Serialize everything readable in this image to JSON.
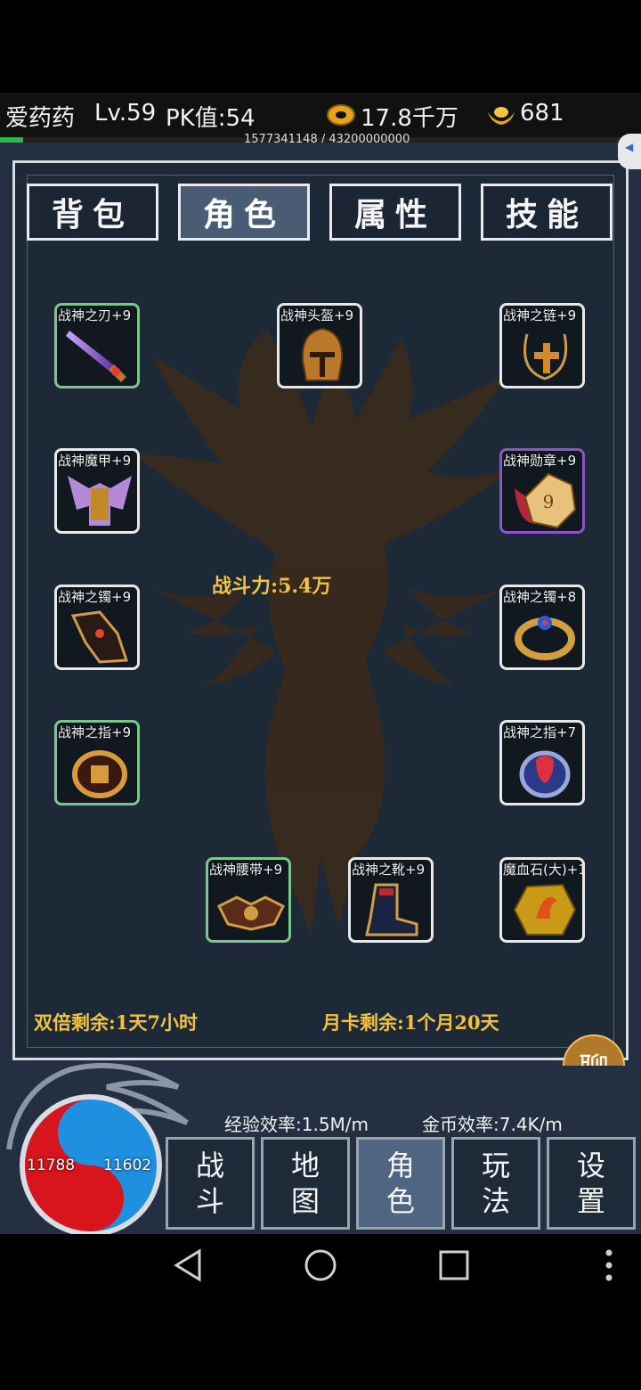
{
  "header": {
    "player_name": "爱药药",
    "level": "Lv.59",
    "pk": "PK值:54",
    "gold": "17.8千万",
    "ingots": "681",
    "exp_progress": "1577341148 / 43200000000",
    "exp_fraction": 0.0365
  },
  "tabs": [
    {
      "label": "背包",
      "active": false
    },
    {
      "label": "角色",
      "active": true
    },
    {
      "label": "属性",
      "active": false
    },
    {
      "label": "技能",
      "active": false
    }
  ],
  "equipment": {
    "weapon": {
      "label": "战神之刃+9",
      "icon": "sword-icon",
      "rarity": "green"
    },
    "helmet": {
      "label": "战神头盔+9",
      "icon": "helmet-icon",
      "rarity": "white"
    },
    "necklace": {
      "label": "战神之链+9",
      "icon": "necklace-icon",
      "rarity": "white"
    },
    "armor": {
      "label": "战神魔甲+9",
      "icon": "armor-icon",
      "rarity": "white"
    },
    "medal": {
      "label": "战神勋章+9",
      "icon": "medal-icon",
      "rarity": "purple"
    },
    "bracelet_left": {
      "label": "战神之镯+9",
      "icon": "gauntlet-icon",
      "rarity": "white"
    },
    "bracelet_right": {
      "label": "战神之镯+8",
      "icon": "bracelet-icon",
      "rarity": "white"
    },
    "ring_left": {
      "label": "战神之指+9",
      "icon": "ring-icon",
      "rarity": "green"
    },
    "ring_right": {
      "label": "战神之指+7",
      "icon": "ring-icon",
      "rarity": "white"
    },
    "belt": {
      "label": "战神腰带+9",
      "icon": "belt-icon",
      "rarity": "green"
    },
    "boots": {
      "label": "战神之靴+9",
      "icon": "boots-icon",
      "rarity": "white"
    },
    "gem": {
      "label": "魔血石(大)+1",
      "icon": "gem-icon",
      "rarity": "white"
    }
  },
  "combat_power": "战斗力:5.4万",
  "double_exp": "双倍剩余:1天7小时",
  "monthly_card": "月卡剩余:1个月20天",
  "chat_button": "聊",
  "efficiency": {
    "exp": "经验效率:1.5M/m",
    "gold": "金币效率:7.4K/m"
  },
  "orb": {
    "hp": "11788",
    "mp": "11602"
  },
  "nav": [
    {
      "label": "战\n斗",
      "active": false
    },
    {
      "label": "地\n图",
      "active": false
    },
    {
      "label": "角\n色",
      "active": true
    },
    {
      "label": "玩\n法",
      "active": false
    },
    {
      "label": "设\n置",
      "active": false
    }
  ],
  "colors": {
    "gold_text": "#f2c23a",
    "panel": "#1e2937",
    "hp_red": "#d8141c",
    "mp_blue": "#1f8fe0",
    "active_tab": "#4a5c74"
  }
}
